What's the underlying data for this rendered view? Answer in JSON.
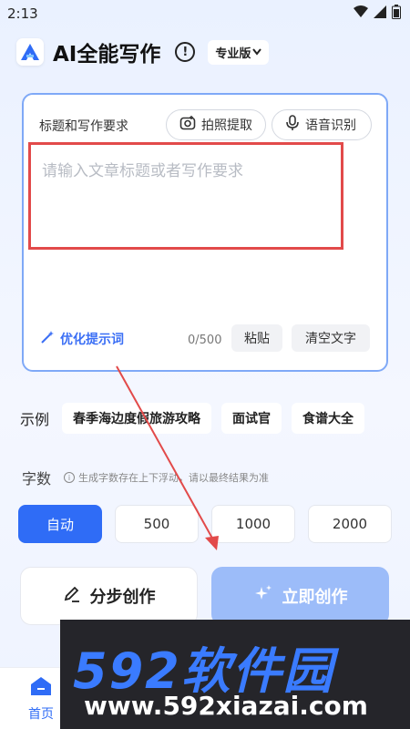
{
  "status_bar": {
    "time": "2:13"
  },
  "header": {
    "title": "AI全能写作",
    "version_label": "专业版"
  },
  "input_card": {
    "label": "标题和写作要求",
    "photo_button": "拍照提取",
    "voice_button": "语音识别",
    "placeholder": "请输入文章标题或者写作要求",
    "value": "",
    "optimize_label": "优化提示词",
    "char_count": "0/500",
    "paste_button": "粘贴",
    "clear_button": "清空文字"
  },
  "examples": {
    "label": "示例",
    "items": [
      "春季海边度假旅游攻略",
      "面试官",
      "食谱大全"
    ]
  },
  "word_count": {
    "label": "字数",
    "hint": "生成字数存在上下浮动，请以最终结果为准",
    "options": [
      "自动",
      "500",
      "1000",
      "2000"
    ],
    "selected": "自动"
  },
  "actions": {
    "step_label": "分步创作",
    "create_label": "立即创作"
  },
  "bottom_nav": {
    "home_label": "首页"
  },
  "watermark": {
    "brand": "592软件园",
    "url": "www.592xiazai.com"
  },
  "colors": {
    "accent": "#2f6cf6",
    "create_button": "#9cbcf9",
    "highlight_box": "#e24a4a",
    "annotation_arrow": "#e24a4a"
  }
}
